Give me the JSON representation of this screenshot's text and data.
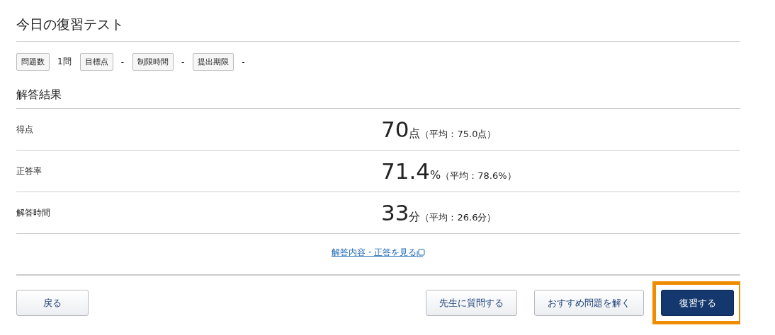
{
  "title": "今日の復習テスト",
  "info": [
    {
      "label": "問題数",
      "value": "1問"
    },
    {
      "label": "目標点",
      "value": "-"
    },
    {
      "label": "制限時間",
      "value": "-"
    },
    {
      "label": "提出期限",
      "value": "-"
    }
  ],
  "results": {
    "heading": "解答結果",
    "rows": [
      {
        "label": "得点",
        "value": "70",
        "unit": "点",
        "average": "（平均：75.0点）"
      },
      {
        "label": "正答率",
        "value": "71.4",
        "unit": "%",
        "average": "（平均：78.6%）"
      },
      {
        "label": "解答時間",
        "value": "33",
        "unit": "分",
        "average": "（平均：26.6分）"
      }
    ],
    "link": "解答内容・正答を見る"
  },
  "footer": {
    "back": "戻る",
    "buttons": [
      {
        "label": "先生に質問する",
        "kind": "secondary",
        "highlighted": false
      },
      {
        "label": "おすすめ問題を解く",
        "kind": "secondary",
        "highlighted": false
      },
      {
        "label": "復習する",
        "kind": "primary",
        "highlighted": true
      }
    ]
  }
}
